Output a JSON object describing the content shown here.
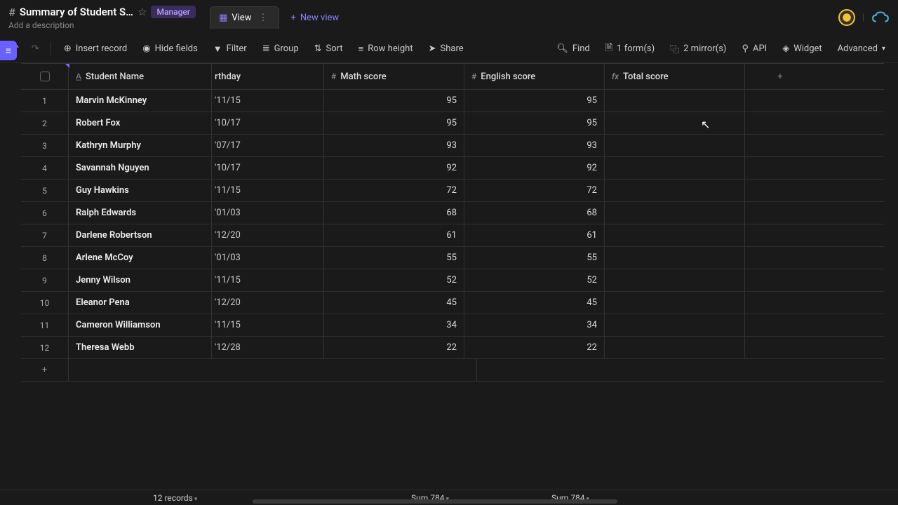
{
  "header": {
    "title": "Summary of Student S…",
    "description": "Add a description",
    "badge": "Manager",
    "view_tab": "View",
    "new_view": "New view"
  },
  "toolbar": {
    "insert_record": "Insert record",
    "hide_fields": "Hide fields",
    "filter": "Filter",
    "group": "Group",
    "sort": "Sort",
    "row_height": "Row height",
    "share": "Share",
    "find": "Find",
    "forms": "1 form(s)",
    "mirrors": "2 mirror(s)",
    "api": "API",
    "widget": "Widget",
    "advanced": "Advanced"
  },
  "columns": {
    "name": "Student Name",
    "birthday": "rthday",
    "math": "Math score",
    "english": "English score",
    "total": "Total score"
  },
  "rows": [
    {
      "n": "1",
      "name": "Marvin McKinney",
      "bday": "'11/15",
      "math": "95",
      "eng": "95"
    },
    {
      "n": "2",
      "name": "Robert Fox",
      "bday": "'10/17",
      "math": "95",
      "eng": "95"
    },
    {
      "n": "3",
      "name": "Kathryn Murphy",
      "bday": "'07/17",
      "math": "93",
      "eng": "93"
    },
    {
      "n": "4",
      "name": "Savannah Nguyen",
      "bday": "'10/17",
      "math": "92",
      "eng": "92"
    },
    {
      "n": "5",
      "name": "Guy Hawkins",
      "bday": "'11/15",
      "math": "72",
      "eng": "72"
    },
    {
      "n": "6",
      "name": "Ralph Edwards",
      "bday": "'01/03",
      "math": "68",
      "eng": "68"
    },
    {
      "n": "7",
      "name": "Darlene Robertson",
      "bday": "'12/20",
      "math": "61",
      "eng": "61"
    },
    {
      "n": "8",
      "name": "Arlene McCoy",
      "bday": "'01/03",
      "math": "55",
      "eng": "55"
    },
    {
      "n": "9",
      "name": "Jenny Wilson",
      "bday": "'11/15",
      "math": "52",
      "eng": "52"
    },
    {
      "n": "10",
      "name": "Eleanor Pena",
      "bday": "'12/20",
      "math": "45",
      "eng": "45"
    },
    {
      "n": "11",
      "name": "Cameron Williamson",
      "bday": "'11/15",
      "math": "34",
      "eng": "34"
    },
    {
      "n": "12",
      "name": "Theresa Webb",
      "bday": "'12/28",
      "math": "22",
      "eng": "22"
    }
  ],
  "footer": {
    "records": "12 records",
    "sum_math": "Sum 784",
    "sum_eng": "Sum 784"
  }
}
